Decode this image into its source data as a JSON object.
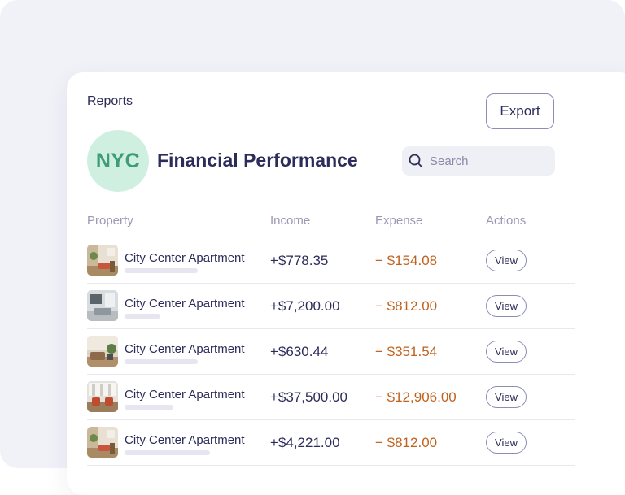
{
  "header": {
    "breadcrumb": "Reports",
    "export_label": "Export",
    "badge_text": "NYC",
    "title": "Financial Performance",
    "search_placeholder": "Search"
  },
  "table": {
    "columns": [
      "Property",
      "Income",
      "Expense",
      "Actions"
    ],
    "rows": [
      {
        "name": "City Center Apartment",
        "income": "+$778.35",
        "expense": "− $154.08",
        "action": "View"
      },
      {
        "name": "City Center Apartment",
        "income": "+$7,200.00",
        "expense": "− $812.00",
        "action": "View"
      },
      {
        "name": "City Center Apartment",
        "income": "+$630.44",
        "expense": "− $351.54",
        "action": "View"
      },
      {
        "name": "City Center Apartment",
        "income": "+$37,500.00",
        "expense": "− $12,906.00",
        "action": "View"
      },
      {
        "name": "City Center Apartment",
        "income": "+$4,221.00",
        "expense": "− $812.00",
        "action": "View"
      }
    ]
  },
  "colors": {
    "primary_text": "#2c2c5a",
    "expense_text": "#c0621d",
    "badge_bg": "#cfefe0",
    "badge_text": "#3e9c78",
    "background": "#f1f1f8"
  }
}
